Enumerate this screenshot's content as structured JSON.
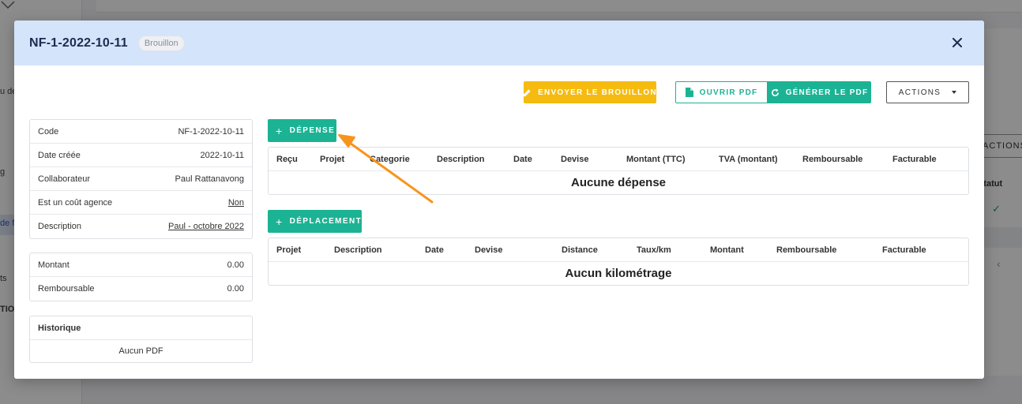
{
  "background": {
    "side_texts": [
      "u de",
      "g",
      "de fr",
      "ts",
      "TIO"
    ],
    "actions_label": "ACTIONS",
    "statut_label": "Statut"
  },
  "modal": {
    "title": "NF-1-2022-10-11",
    "status_badge": "Brouillon"
  },
  "toolbar": {
    "send_draft": "ENVOYER LE BROUILLON",
    "open_pdf": "OUVRIR PDF",
    "generate_pdf": "GÉNÉRER LE PDF",
    "actions": "ACTIONS"
  },
  "info": {
    "rows": [
      {
        "label": "Code",
        "value": "NF-1-2022-10-11"
      },
      {
        "label": "Date créée",
        "value": "2022-10-11"
      },
      {
        "label": "Collaborateur",
        "value": "Paul Rattanavong"
      },
      {
        "label": "Est un coût agence",
        "value": "Non"
      },
      {
        "label": "Description",
        "value": "Paul - octobre 2022"
      }
    ]
  },
  "totals": {
    "rows": [
      {
        "label": "Montant",
        "value": "0.00"
      },
      {
        "label": "Remboursable",
        "value": "0.00"
      }
    ]
  },
  "history": {
    "title": "Historique",
    "empty": "Aucun PDF"
  },
  "expenses": {
    "add_button": "DÉPENSE",
    "columns": [
      "Reçu",
      "Projet",
      "Categorie",
      "Description",
      "Date",
      "Devise",
      "Montant (TTC)",
      "TVA (montant)",
      "Remboursable",
      "Facturable"
    ],
    "empty": "Aucune dépense"
  },
  "mileage": {
    "add_button": "DÉPLACEMENT",
    "columns": [
      "Projet",
      "Description",
      "Date",
      "Devise",
      "Distance",
      "Taux/km",
      "Montant",
      "Remboursable",
      "Facturable"
    ],
    "empty": "Aucun kilométrage"
  },
  "colors": {
    "header_bg": "#d4e4fb",
    "primary_green": "#1bb394",
    "warning_yellow": "#f5bb10",
    "annotation_arrow": "#f7941d"
  }
}
